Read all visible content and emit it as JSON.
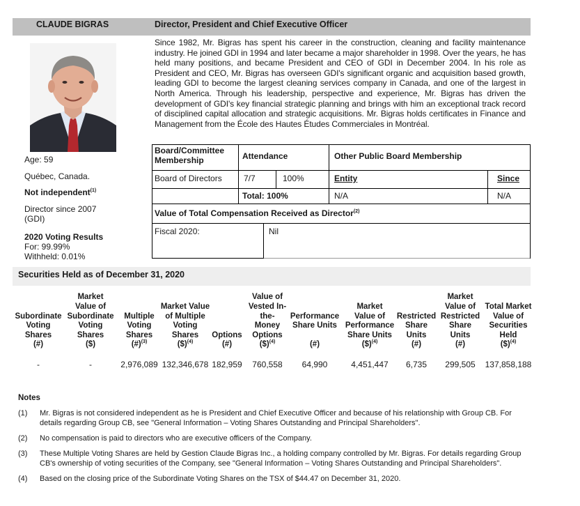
{
  "header": {
    "name": "CLAUDE BIGRAS",
    "role": "Director, President and Chief Executive Officer"
  },
  "bio": "Since 1982, Mr. Bigras has spent his career in the construction, cleaning and facility maintenance industry. He joined GDI in 1994 and later became a major shareholder in 1998. Over the years, he has held many positions, and became President and CEO of GDI in December 2004. In his role as President and CEO, Mr. Bigras has overseen GDI's significant organic and acquisition based growth, leading GDI to become the largest cleaning services company in Canada, and one of the largest in North America. Through his leadership, perspective and experience, Mr. Bigras has driven the development of GDI's key financial strategic planning and brings with him an exceptional track record of disciplined capital allocation and strategic acquisitions. Mr. Bigras holds certificates in Finance and Management from the École des Hautes Études Commerciales in Montréal.",
  "profile": {
    "age": "Age: 59",
    "location": "Québec, Canada.",
    "independence": "Not independent",
    "independence_note": "(1)",
    "director_since_1": "Director since 2007",
    "director_since_2": "(GDI)",
    "voting_title": "2020 Voting Results",
    "voting_for": "For: 99.99%",
    "voting_withheld": "Withheld: 0.01%"
  },
  "board": {
    "col1_header_1": "Board/Committee",
    "col1_header_2": "Membership",
    "col2_header": "Attendance",
    "col3_header": "Other Public Board Membership",
    "row_name": "Board of Directors",
    "row_meetings": "7/7",
    "row_percent": "100%",
    "entity_label": "Entity",
    "since_label": "Since",
    "total_label": "Total: 100%",
    "entity_value": "N/A",
    "since_value": "N/A",
    "comp_title": "Value of Total Compensation Received as Director",
    "comp_note": "(2)",
    "fiscal_label": "Fiscal 2020:",
    "fiscal_value": "Nil"
  },
  "securities": {
    "title": "Securities Held as of December 31, 2020",
    "columns": [
      {
        "lines": [
          "Subordinate",
          "Voting",
          "Shares",
          "(#)"
        ],
        "sup": "",
        "value": "-"
      },
      {
        "lines": [
          "Market",
          "Value of",
          "Subordinate",
          "Voting",
          "Shares",
          "($)"
        ],
        "sup": "",
        "value": "-"
      },
      {
        "lines": [
          "Multiple",
          "Voting",
          "Shares",
          "(#)"
        ],
        "sup": "(3)",
        "value": "2,976,089"
      },
      {
        "lines": [
          "Market Value",
          "of Multiple",
          "Voting",
          "Shares",
          "($)"
        ],
        "sup": "(4)",
        "value": "132,346,678"
      },
      {
        "lines": [
          "Options",
          "(#)"
        ],
        "sup": "",
        "value": "182,959"
      },
      {
        "lines": [
          "Value of",
          "Vested In-",
          "the-",
          "Money",
          "Options",
          "($)"
        ],
        "sup": "(4)",
        "value": "760,558"
      },
      {
        "lines": [
          "Performance",
          "Share Units",
          "",
          "(#)"
        ],
        "sup": "",
        "value": "64,990"
      },
      {
        "lines": [
          "Market",
          "Value of",
          "Performance",
          "Share Units",
          "($)"
        ],
        "sup": "(4)",
        "value": "4,451,447"
      },
      {
        "lines": [
          "Restricted",
          "Share",
          "Units",
          "(#)"
        ],
        "sup": "",
        "value": "6,735"
      },
      {
        "lines": [
          "Market",
          "Value of",
          "Restricted",
          "Share",
          "Units",
          "(#)"
        ],
        "sup": "",
        "value": "299,505"
      },
      {
        "lines": [
          "Total Market",
          "Value of",
          "Securities",
          "Held",
          "($)"
        ],
        "sup": "(4)",
        "value": "137,858,188"
      }
    ]
  },
  "notes": {
    "title": "Notes",
    "items": [
      {
        "num": "(1)",
        "text": "Mr. Bigras is not considered independent as he is President and Chief Executive Officer and because of his relationship with Group CB. For details regarding Group CB, see \"General Information – Voting Shares Outstanding and Principal Shareholders\"."
      },
      {
        "num": "(2)",
        "text": "No compensation is paid to directors who are executive officers of the Company."
      },
      {
        "num": "(3)",
        "text": "These Multiple Voting Shares are held by Gestion Claude Bigras Inc., a holding company controlled by Mr. Bigras. For details regarding Group CB's ownership of voting securities of the Company, see \"General Information – Voting Shares Outstanding and Principal Shareholders\"."
      },
      {
        "num": "(4)",
        "text": "Based on the closing price of the Subordinate Voting Shares on the TSX of $44.47 on December 31, 2020."
      }
    ]
  }
}
